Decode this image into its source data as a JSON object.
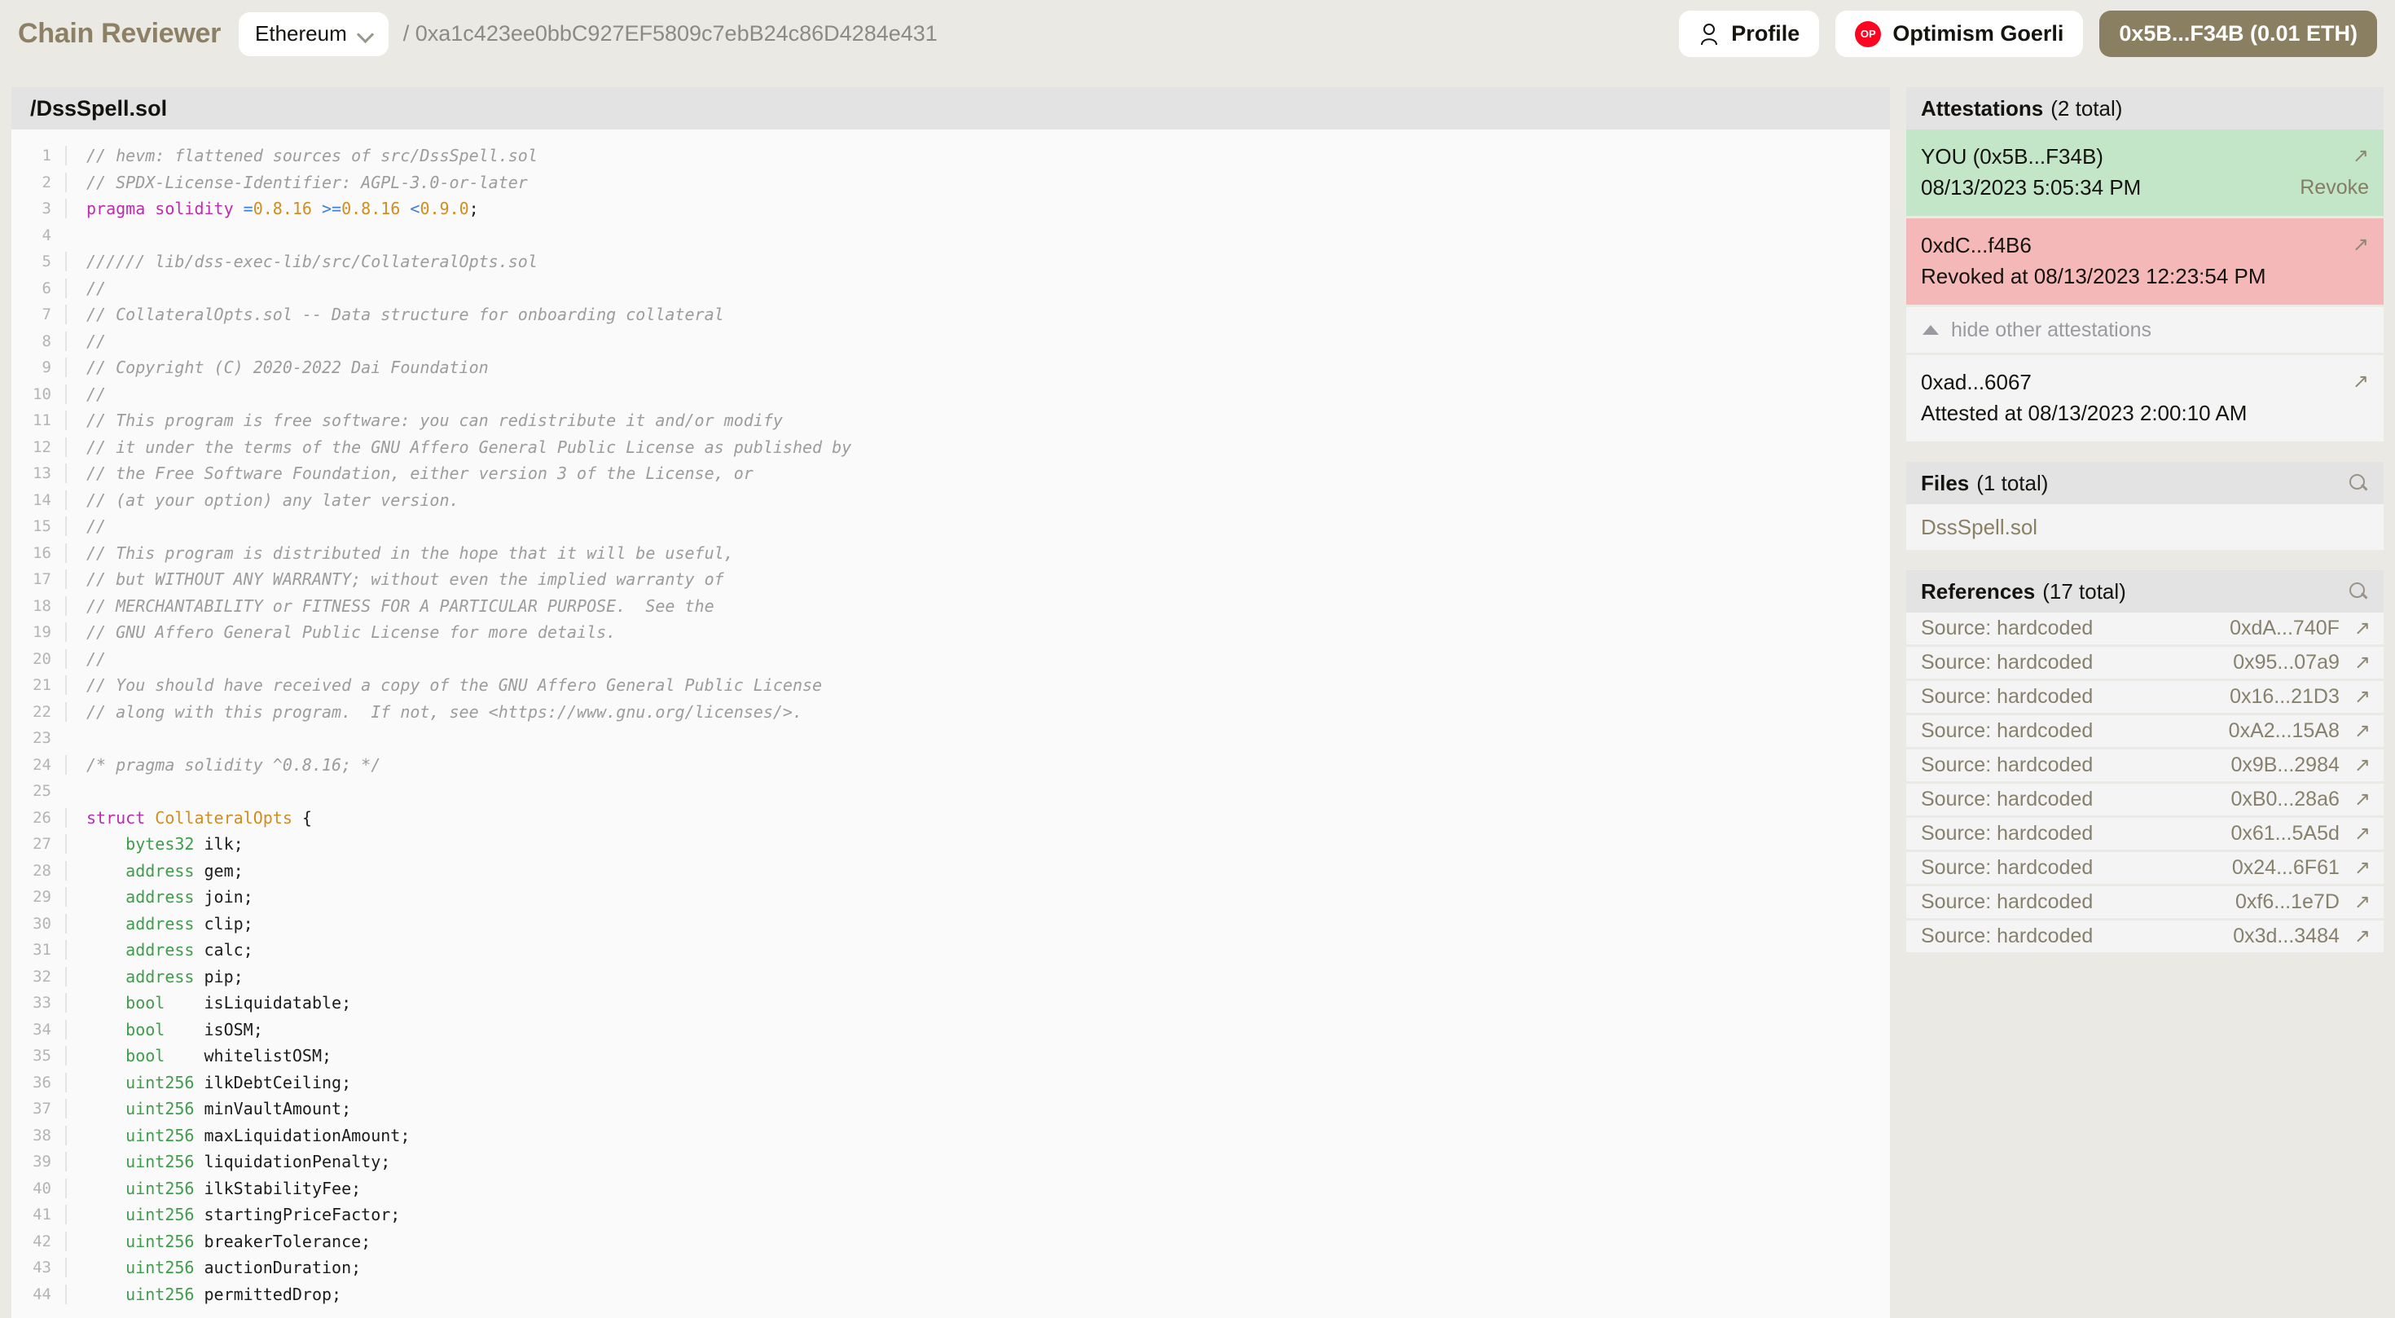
{
  "header": {
    "brand": "Chain Reviewer",
    "chain_select": {
      "label": "Ethereum",
      "icon": "chevron-down-icon"
    },
    "breadcrumb_address": "/ 0xa1c423ee0bbC927EF5809c7ebB24c86D4284e431",
    "profile_button": "Profile",
    "network_button": "Optimism Goerli",
    "network_badge": "OP",
    "wallet_button": "0x5B...F34B (0.01 ETH)",
    "accent_gold": "#8b7f62",
    "op_red": "#ff0420"
  },
  "code_panel": {
    "file_path": "/DssSpell.sol",
    "lines": [
      {
        "n": "1",
        "tokens": [
          {
            "t": "// hevm: flattened sources of src/DssSpell.sol",
            "c": "cm"
          }
        ]
      },
      {
        "n": "2",
        "tokens": [
          {
            "t": "// SPDX-License-Identifier: AGPL-3.0-or-later",
            "c": "cm"
          }
        ]
      },
      {
        "n": "3",
        "tokens": [
          {
            "t": "pragma solidity ",
            "c": "kw"
          },
          {
            "t": "=",
            "c": "op"
          },
          {
            "t": "0.8.16",
            "c": "num"
          },
          {
            "t": " ",
            "c": ""
          },
          {
            "t": ">=",
            "c": "op"
          },
          {
            "t": "0.8.16",
            "c": "num"
          },
          {
            "t": " ",
            "c": ""
          },
          {
            "t": "<",
            "c": "op"
          },
          {
            "t": "0.9.0",
            "c": "num"
          },
          {
            "t": ";",
            "c": ""
          }
        ]
      },
      {
        "n": "4",
        "tokens": [
          {
            "t": "",
            "c": ""
          }
        ]
      },
      {
        "n": "5",
        "tokens": [
          {
            "t": "////// lib/dss-exec-lib/src/CollateralOpts.sol",
            "c": "cm"
          }
        ]
      },
      {
        "n": "6",
        "tokens": [
          {
            "t": "//",
            "c": "cm"
          }
        ]
      },
      {
        "n": "7",
        "tokens": [
          {
            "t": "// CollateralOpts.sol -- Data structure for onboarding collateral",
            "c": "cm"
          }
        ]
      },
      {
        "n": "8",
        "tokens": [
          {
            "t": "//",
            "c": "cm"
          }
        ]
      },
      {
        "n": "9",
        "tokens": [
          {
            "t": "// Copyright (C) 2020-2022 Dai Foundation",
            "c": "cm"
          }
        ]
      },
      {
        "n": "10",
        "tokens": [
          {
            "t": "//",
            "c": "cm"
          }
        ]
      },
      {
        "n": "11",
        "tokens": [
          {
            "t": "// This program is free software: you can redistribute it and/or modify",
            "c": "cm"
          }
        ]
      },
      {
        "n": "12",
        "tokens": [
          {
            "t": "// it under the terms of the GNU Affero General Public License as published by",
            "c": "cm"
          }
        ]
      },
      {
        "n": "13",
        "tokens": [
          {
            "t": "// the Free Software Foundation, either version 3 of the License, or",
            "c": "cm"
          }
        ]
      },
      {
        "n": "14",
        "tokens": [
          {
            "t": "// (at your option) any later version.",
            "c": "cm"
          }
        ]
      },
      {
        "n": "15",
        "tokens": [
          {
            "t": "//",
            "c": "cm"
          }
        ]
      },
      {
        "n": "16",
        "tokens": [
          {
            "t": "// This program is distributed in the hope that it will be useful,",
            "c": "cm"
          }
        ]
      },
      {
        "n": "17",
        "tokens": [
          {
            "t": "// but WITHOUT ANY WARRANTY; without even the implied warranty of",
            "c": "cm"
          }
        ]
      },
      {
        "n": "18",
        "tokens": [
          {
            "t": "// MERCHANTABILITY or FITNESS FOR A PARTICULAR PURPOSE.  See the",
            "c": "cm"
          }
        ]
      },
      {
        "n": "19",
        "tokens": [
          {
            "t": "// GNU Affero General Public License for more details.",
            "c": "cm"
          }
        ]
      },
      {
        "n": "20",
        "tokens": [
          {
            "t": "//",
            "c": "cm"
          }
        ]
      },
      {
        "n": "21",
        "tokens": [
          {
            "t": "// You should have received a copy of the GNU Affero General Public License",
            "c": "cm"
          }
        ]
      },
      {
        "n": "22",
        "tokens": [
          {
            "t": "// along with this program.  If not, see <https://www.gnu.org/licenses/>.",
            "c": "cm"
          }
        ]
      },
      {
        "n": "23",
        "tokens": [
          {
            "t": "",
            "c": ""
          }
        ]
      },
      {
        "n": "24",
        "tokens": [
          {
            "t": "/* pragma solidity ^0.8.16; */",
            "c": "cm"
          }
        ]
      },
      {
        "n": "25",
        "tokens": [
          {
            "t": "",
            "c": ""
          }
        ]
      },
      {
        "n": "26",
        "tokens": [
          {
            "t": "struct ",
            "c": "kw"
          },
          {
            "t": "CollateralOpts",
            "c": "cls"
          },
          {
            "t": " {",
            "c": ""
          }
        ]
      },
      {
        "n": "27",
        "tokens": [
          {
            "t": "    ",
            "c": ""
          },
          {
            "t": "bytes32",
            "c": "ty"
          },
          {
            "t": " ilk;",
            "c": ""
          }
        ]
      },
      {
        "n": "28",
        "tokens": [
          {
            "t": "    ",
            "c": ""
          },
          {
            "t": "address",
            "c": "ty"
          },
          {
            "t": " gem;",
            "c": ""
          }
        ]
      },
      {
        "n": "29",
        "tokens": [
          {
            "t": "    ",
            "c": ""
          },
          {
            "t": "address",
            "c": "ty"
          },
          {
            "t": " join;",
            "c": ""
          }
        ]
      },
      {
        "n": "30",
        "tokens": [
          {
            "t": "    ",
            "c": ""
          },
          {
            "t": "address",
            "c": "ty"
          },
          {
            "t": " clip;",
            "c": ""
          }
        ]
      },
      {
        "n": "31",
        "tokens": [
          {
            "t": "    ",
            "c": ""
          },
          {
            "t": "address",
            "c": "ty"
          },
          {
            "t": " calc;",
            "c": ""
          }
        ]
      },
      {
        "n": "32",
        "tokens": [
          {
            "t": "    ",
            "c": ""
          },
          {
            "t": "address",
            "c": "ty"
          },
          {
            "t": " pip;",
            "c": ""
          }
        ]
      },
      {
        "n": "33",
        "tokens": [
          {
            "t": "    ",
            "c": ""
          },
          {
            "t": "bool",
            "c": "ty"
          },
          {
            "t": "    isLiquidatable;",
            "c": ""
          }
        ]
      },
      {
        "n": "34",
        "tokens": [
          {
            "t": "    ",
            "c": ""
          },
          {
            "t": "bool",
            "c": "ty"
          },
          {
            "t": "    isOSM;",
            "c": ""
          }
        ]
      },
      {
        "n": "35",
        "tokens": [
          {
            "t": "    ",
            "c": ""
          },
          {
            "t": "bool",
            "c": "ty"
          },
          {
            "t": "    whitelistOSM;",
            "c": ""
          }
        ]
      },
      {
        "n": "36",
        "tokens": [
          {
            "t": "    ",
            "c": ""
          },
          {
            "t": "uint256",
            "c": "ty"
          },
          {
            "t": " ilkDebtCeiling;",
            "c": ""
          }
        ]
      },
      {
        "n": "37",
        "tokens": [
          {
            "t": "    ",
            "c": ""
          },
          {
            "t": "uint256",
            "c": "ty"
          },
          {
            "t": " minVaultAmount;",
            "c": ""
          }
        ]
      },
      {
        "n": "38",
        "tokens": [
          {
            "t": "    ",
            "c": ""
          },
          {
            "t": "uint256",
            "c": "ty"
          },
          {
            "t": " maxLiquidationAmount;",
            "c": ""
          }
        ]
      },
      {
        "n": "39",
        "tokens": [
          {
            "t": "    ",
            "c": ""
          },
          {
            "t": "uint256",
            "c": "ty"
          },
          {
            "t": " liquidationPenalty;",
            "c": ""
          }
        ]
      },
      {
        "n": "40",
        "tokens": [
          {
            "t": "    ",
            "c": ""
          },
          {
            "t": "uint256",
            "c": "ty"
          },
          {
            "t": " ilkStabilityFee;",
            "c": ""
          }
        ]
      },
      {
        "n": "41",
        "tokens": [
          {
            "t": "    ",
            "c": ""
          },
          {
            "t": "uint256",
            "c": "ty"
          },
          {
            "t": " startingPriceFactor;",
            "c": ""
          }
        ]
      },
      {
        "n": "42",
        "tokens": [
          {
            "t": "    ",
            "c": ""
          },
          {
            "t": "uint256",
            "c": "ty"
          },
          {
            "t": " breakerTolerance;",
            "c": ""
          }
        ]
      },
      {
        "n": "43",
        "tokens": [
          {
            "t": "    ",
            "c": ""
          },
          {
            "t": "uint256",
            "c": "ty"
          },
          {
            "t": " auctionDuration;",
            "c": ""
          }
        ]
      },
      {
        "n": "44",
        "tokens": [
          {
            "t": "    ",
            "c": ""
          },
          {
            "t": "uint256",
            "c": "ty"
          },
          {
            "t": " permittedDrop;",
            "c": ""
          }
        ]
      }
    ]
  },
  "sidebar": {
    "attestations": {
      "title": "Attestations",
      "count": "(2 total)",
      "items": [
        {
          "style": "green",
          "address": "YOU (0x5B...F34B)",
          "detail": "08/13/2023 5:05:34 PM",
          "action": "Revoke",
          "link_icon": "external-link-icon"
        },
        {
          "style": "red",
          "address": "0xdC...f4B6",
          "detail": "Revoked at 08/13/2023 12:23:54 PM",
          "action": "",
          "link_icon": "external-link-icon"
        }
      ],
      "toggle": {
        "label": "hide other attestations",
        "icon": "triangle-up-icon"
      },
      "other_items": [
        {
          "style": "plain",
          "address": "0xad...6067",
          "detail": "Attested at 08/13/2023 2:00:10 AM",
          "action": "",
          "link_icon": "external-link-icon"
        }
      ]
    },
    "files": {
      "title": "Files",
      "count": "(1 total)",
      "search_icon": "search-icon",
      "items": [
        {
          "name": "DssSpell.sol"
        }
      ]
    },
    "references": {
      "title": "References",
      "count": "(17 total)",
      "search_icon": "search-icon",
      "items": [
        {
          "source": "Source: hardcoded",
          "address": "0xdA...740F"
        },
        {
          "source": "Source: hardcoded",
          "address": "0x95...07a9"
        },
        {
          "source": "Source: hardcoded",
          "address": "0x16...21D3"
        },
        {
          "source": "Source: hardcoded",
          "address": "0xA2...15A8"
        },
        {
          "source": "Source: hardcoded",
          "address": "0x9B...2984"
        },
        {
          "source": "Source: hardcoded",
          "address": "0xB0...28a6"
        },
        {
          "source": "Source: hardcoded",
          "address": "0x61...5A5d"
        },
        {
          "source": "Source: hardcoded",
          "address": "0x24...6F61"
        },
        {
          "source": "Source: hardcoded",
          "address": "0xf6...1e7D"
        },
        {
          "source": "Source: hardcoded",
          "address": "0x3d...3484"
        }
      ]
    }
  }
}
